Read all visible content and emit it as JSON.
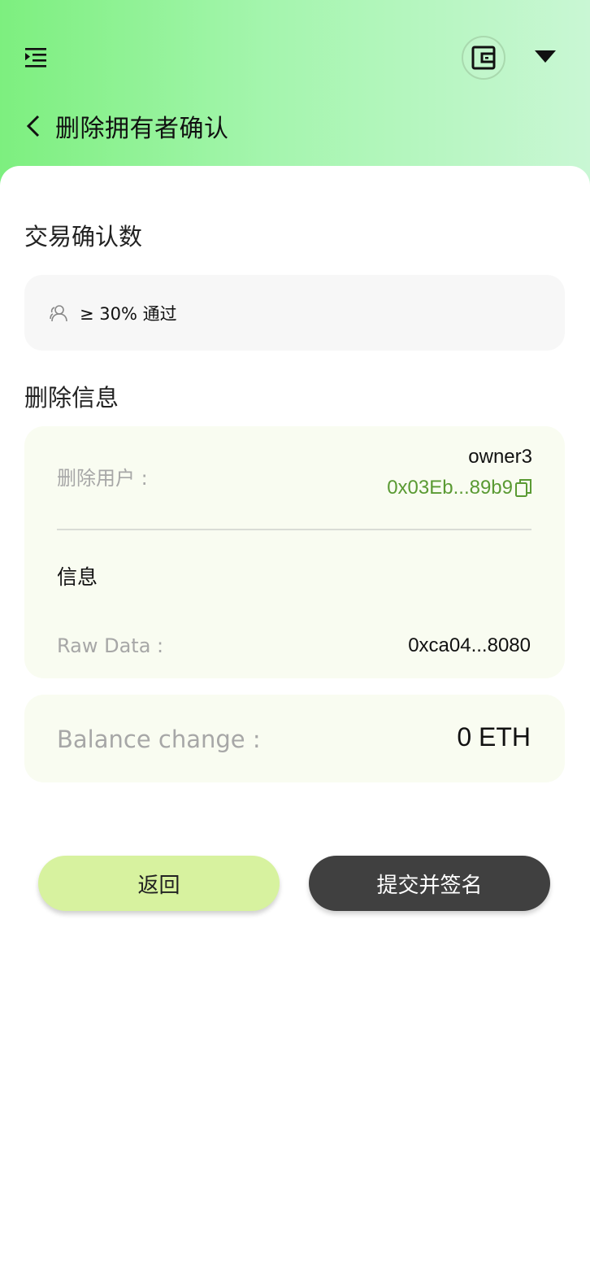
{
  "header": {
    "title": "删除拥有者确认",
    "icons": {
      "menu": "menu-indent-icon",
      "wallet": "wallet-icon",
      "dropdown": "caret-down-icon",
      "back": "chevron-left-icon"
    }
  },
  "confirmations": {
    "section_title": "交易确认数",
    "threshold_text": "≥ 30% 通过",
    "icon": "people-icon"
  },
  "delete_info": {
    "section_title": "删除信息",
    "user_label": "删除用户 :",
    "owner_name": "owner3",
    "owner_address": "0x03Eb...89b9",
    "message_title": "信息",
    "raw_data_label": "Raw Data :",
    "raw_data_value": "0xca04...8080"
  },
  "balance": {
    "label": "Balance change :",
    "value": "0 ETH"
  },
  "actions": {
    "back_label": "返回",
    "submit_label": "提交并签名"
  },
  "colors": {
    "accent_green": "#5a9a33",
    "back_button": "#d7f29f",
    "submit_button": "#404040",
    "card_background": "#f9fcf1"
  }
}
